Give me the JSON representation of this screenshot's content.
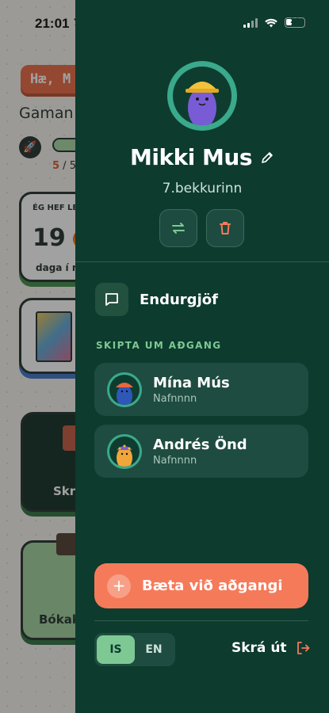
{
  "status_bar": {
    "time": "21:01",
    "battery": "29"
  },
  "background": {
    "greeting": "Hæ, M",
    "subtitle": "Gaman",
    "progress_current": "5",
    "progress_rest": " / 5",
    "streak_heading": "ÉG HEF LE",
    "streak_count": "19",
    "streak_label": "daga í rö",
    "card3_label": "Skr",
    "card4_label": "Bókak"
  },
  "drawer": {
    "profile": {
      "name": "Mikki Mus",
      "grade": "7.bekkurinn"
    },
    "feedback_label": "Endurgjöf",
    "section_title": "SKIPTA UM AÐGANG",
    "accounts": [
      {
        "name": "Mína Mús",
        "username": "Nafnnnn",
        "cap_color": "#e8673f",
        "body_color": "#2e57b8"
      },
      {
        "name": "Andrés Önd",
        "username": "Nafnnnn",
        "cap_color": "#7b5bd0",
        "body_color": "#f0a63a"
      }
    ],
    "add_account_label": "Bæta við aðgangi",
    "language": {
      "options": [
        "IS",
        "EN"
      ],
      "selected": "IS"
    },
    "logout_label": "Skrá út"
  },
  "colors": {
    "drawer_bg": "#0d3b2e",
    "accent": "#f57a5a",
    "green": "#7ec894"
  }
}
